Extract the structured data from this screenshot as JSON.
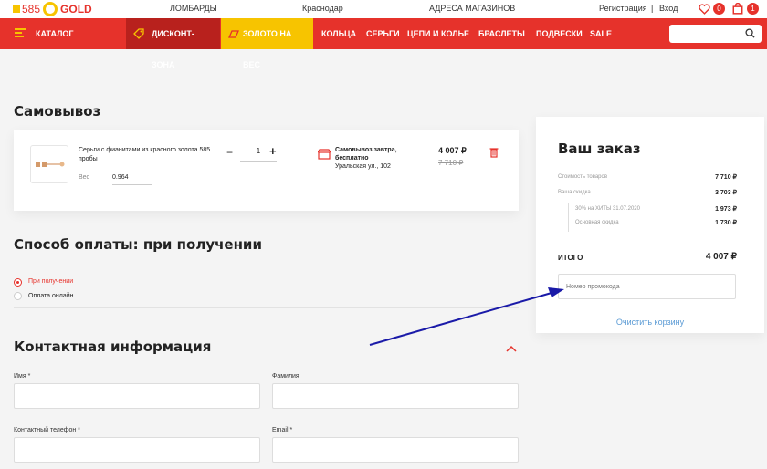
{
  "header": {
    "logo_num": "585",
    "logo_text": "GOLD",
    "links": [
      "ЛОМБАРДЫ",
      "Краснодар",
      "АДРЕСА МАГАЗИНОВ"
    ],
    "register": "Регистрация",
    "separator": "|",
    "login": "Вход",
    "favorites_count": "0",
    "cart_count": "1"
  },
  "nav": {
    "catalog": "КАТАЛОГ",
    "discount": "ДИСКОНТ-ЗОНА",
    "gold_weight": "ЗОЛОТО НА ВЕС",
    "items": [
      "КОЛЬЦА",
      "СЕРЬГИ",
      "ЦЕПИ И КОЛЬЕ",
      "БРАСЛЕТЫ",
      "ПОДВЕСКИ",
      "SALE"
    ]
  },
  "pickup": {
    "title": "Самовывоз",
    "product_name": "Серьги с фианитами из красного золота 585 пробы",
    "weight_label": "Вес",
    "weight_value": "0.964",
    "minus": "−",
    "qty": "1",
    "plus": "+",
    "delivery_text": "Самовывоз завтра, бесплатно",
    "delivery_address": "Уральская ул., 102",
    "price": "4 007 ₽",
    "old_price": "7 710 ₽"
  },
  "payment": {
    "title": "Способ оплаты: при получении",
    "options": [
      "При получении",
      "Оплата онлайн"
    ]
  },
  "contact": {
    "title": "Контактная информация",
    "name_label": "Имя *",
    "surname_label": "Фамилия",
    "phone_label": "Контактный телефон *",
    "email_label": "Email *"
  },
  "order": {
    "title": "Ваш заказ",
    "goods_label": "Стоимость товаров",
    "goods_value": "7 710 ₽",
    "discount_label": "Ваша скидка",
    "discount_value": "3 703 ₽",
    "sub1_label": "30% на ХИТЫ 31.07.2020",
    "sub1_value": "1 973 ₽",
    "sub2_label": "Основная скидка",
    "sub2_value": "1 730 ₽",
    "total_label": "ИТОГО",
    "total_value": "4 007 ₽",
    "promo_placeholder": "Номер промокода",
    "clear_cart": "Очистить корзину"
  },
  "colors": {
    "accent": "#e6322b",
    "gold": "#f7c400",
    "link": "#5b9bd5",
    "arrow": "#1a1aa8"
  }
}
